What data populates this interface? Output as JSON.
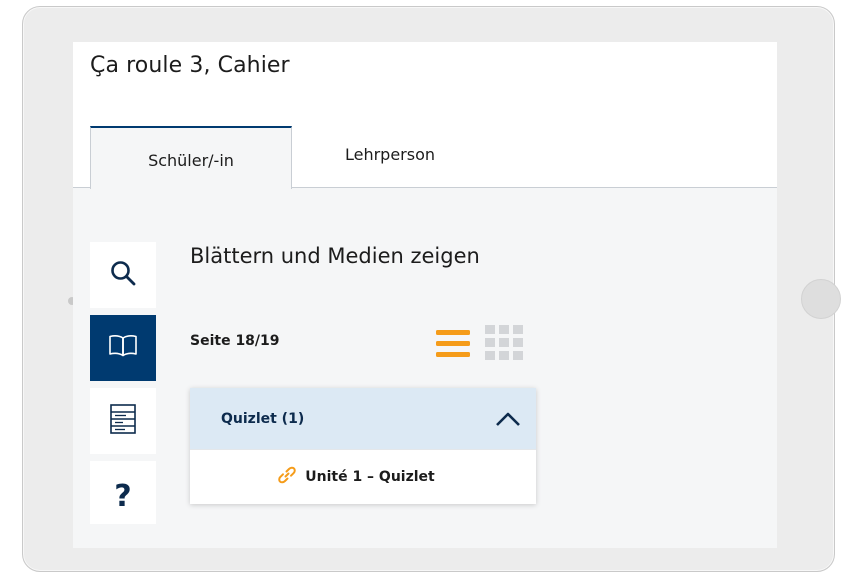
{
  "app": {
    "title": "Ça roule 3, Cahier"
  },
  "tabs": [
    {
      "label": "Schüler/-in",
      "active": true
    },
    {
      "label": "Lehrperson",
      "active": false
    }
  ],
  "sidebar": {
    "items": [
      {
        "icon": "search-icon",
        "active": false
      },
      {
        "icon": "book-icon",
        "active": true
      },
      {
        "icon": "table-of-contents-icon",
        "active": false
      },
      {
        "icon": "help-icon",
        "glyph": "?",
        "active": false
      }
    ]
  },
  "main": {
    "heading": "Blättern und Medien zeigen",
    "page_indicator": "Seite 18/19",
    "view_modes": [
      {
        "icon": "list-view-icon",
        "active": true
      },
      {
        "icon": "grid-view-icon",
        "active": false
      }
    ],
    "accordion": {
      "title": "Quizlet (1)",
      "expanded": true,
      "items": [
        {
          "icon": "link-icon",
          "label": "Unité 1 – Quizlet"
        }
      ]
    }
  },
  "colors": {
    "brand_navy": "#003a70",
    "accent_orange": "#f59c1a",
    "accordion_header": "#dce9f4",
    "page_background": "#f5f6f7"
  }
}
